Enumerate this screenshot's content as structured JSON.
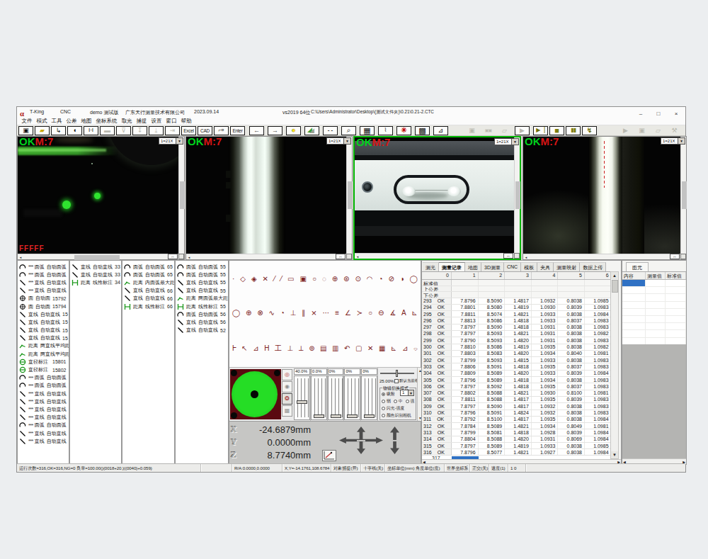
{
  "title": {
    "logo": "α",
    "app_name": "T-King",
    "mode": "CNC",
    "user": "demo 测试版",
    "company": "广东天行测量技术有限公司",
    "date": "2023.09.14",
    "build": "vs2019 64位",
    "file_path": "C:\\Users\\Administrator\\Desktop\\(测试文件夹)\\0.21\\0.21-2.CTC",
    "minimize": "–",
    "maximize": "□",
    "close": "×"
  },
  "menu": [
    "文件",
    "模式",
    "工具",
    "公差",
    "地图",
    "坐标系统",
    "取光",
    "捕捉",
    "设置",
    "窗口",
    "帮助"
  ],
  "toolbar": [
    {
      "name": "save-button",
      "icon": "save",
      "flags": ""
    },
    {
      "name": "open-button",
      "icon": "open",
      "flags": ""
    },
    {
      "name": "probe-button",
      "icon": "probe",
      "flags": ""
    },
    {
      "name": "shield-button",
      "icon": "shield",
      "flags": ""
    },
    {
      "name": "caliper-button",
      "icon": "caliper",
      "flags": ""
    },
    {
      "name": "gray-rect-button",
      "icon": "grayrect",
      "flags": "dis"
    },
    {
      "name": "bucket-down-button",
      "icon": "bucket-down",
      "flags": "dis"
    },
    {
      "name": "caliper-down-button",
      "icon": "caliper-down",
      "flags": "dis"
    },
    {
      "name": "rect-down-button",
      "icon": "rect-down",
      "flags": "dis"
    },
    {
      "name": "arrow-down-button",
      "icon": "arrow-down",
      "flags": "dis"
    },
    {
      "name": "excel-button",
      "label": "Excel",
      "flags": ""
    },
    {
      "name": "cad-button",
      "label": "CAD",
      "flags": ""
    },
    {
      "name": "pipe-button",
      "icon": "pipe",
      "flags": ""
    },
    {
      "name": "enter-button",
      "label": "Enter",
      "flags": ""
    },
    {
      "name": "back-button",
      "icon": "arrow-left",
      "flags": "ga w5"
    },
    {
      "name": "forward-button",
      "icon": "arrow-right",
      "flags": "w5"
    },
    {
      "name": "light-bulb-button",
      "icon": "bulb",
      "flags": "w5"
    },
    {
      "name": "image-button",
      "icon": "image",
      "flags": "w5"
    },
    {
      "name": "dashes-button",
      "icon": "dashes",
      "flags": "w5"
    },
    {
      "name": "zoom-cancel-button",
      "icon": "zoom-cancel",
      "flags": "w5"
    },
    {
      "name": "checker-button",
      "icon": "checker",
      "flags": "w5"
    },
    {
      "name": "marquee-button",
      "icon": "marquee",
      "flags": "w5"
    },
    {
      "name": "burst-button",
      "icon": "burst",
      "flags": "w5"
    },
    {
      "name": "qr-button",
      "icon": "qr",
      "flags": "w5"
    },
    {
      "name": "chart-button",
      "icon": "chart",
      "flags": ""
    },
    {
      "name": "save-flat-button",
      "icon": "save",
      "flags": "gb flat dis"
    },
    {
      "name": "multisave-flat-button",
      "icon": "multisave",
      "flags": "flat dis"
    },
    {
      "name": "folder-flat-button",
      "icon": "folder",
      "flags": "flat dis"
    },
    {
      "name": "play-button",
      "icon": "play",
      "flags": "gc dis"
    },
    {
      "name": "step-button",
      "icon": "step",
      "flags": "gd"
    },
    {
      "name": "stop-button",
      "icon": "stop",
      "flags": ""
    },
    {
      "name": "pause-button",
      "icon": "pause",
      "flags": ""
    },
    {
      "name": "run-button",
      "icon": "run",
      "flags": ""
    },
    {
      "name": "play2-flat-button",
      "icon": "play",
      "flags": "ge flat dis"
    },
    {
      "name": "save2-flat-button",
      "icon": "save",
      "flags": "flat dis"
    },
    {
      "name": "folder2-flat-button",
      "icon": "folder",
      "flags": "flat dis"
    },
    {
      "name": "tools-flat-button",
      "icon": "tools",
      "flags": "flat dis"
    }
  ],
  "cameras": [
    {
      "status": "OK",
      "marker": "M:7",
      "zoom": "1=21X",
      "overlay": "FFFFF"
    },
    {
      "status": "OK",
      "marker": "M:7",
      "zoom": "1=21X"
    },
    {
      "status": "OK",
      "marker": "M:7",
      "zoom": "1=21X",
      "selected": true
    },
    {
      "status": "OK",
      "marker": "M:7",
      "zoom": "1=21X"
    }
  ],
  "lists": {
    "col1": [
      {
        "icon": "arc-icon",
        "stars": "***",
        "name": "圆弧",
        "type": "自动圆弧",
        "num": ""
      },
      {
        "icon": "arc-icon",
        "stars": "***",
        "name": "圆弧",
        "type": "自动圆弧",
        "num": ""
      },
      {
        "icon": "line-icon",
        "stars": "***",
        "name": "直线",
        "type": "自动直线",
        "num": ""
      },
      {
        "icon": "line-icon",
        "stars": "***",
        "name": "直线",
        "type": "自动直线",
        "num": ""
      },
      {
        "icon": "circle-icon",
        "stars": "",
        "name": "圆",
        "type": "自动圆",
        "num": "15792"
      },
      {
        "icon": "circle-icon",
        "stars": "",
        "name": "圆",
        "type": "自动圆",
        "num": "15794"
      },
      {
        "icon": "line-icon",
        "stars": "",
        "name": "直线",
        "type": "自动直线",
        "num": "15"
      },
      {
        "icon": "line-icon",
        "stars": "",
        "name": "直线",
        "type": "自动直线",
        "num": "15"
      },
      {
        "icon": "line-icon",
        "stars": "",
        "name": "直线",
        "type": "自动直线",
        "num": "15"
      },
      {
        "icon": "line-icon",
        "stars": "",
        "name": "直线",
        "type": "自动直线",
        "num": "15"
      },
      {
        "icon": "distance-icon",
        "stars": "",
        "name": "距离",
        "type": "两直线平均距离",
        "num": "",
        "cls": "green"
      },
      {
        "icon": "distance-icon",
        "stars": "",
        "name": "距离",
        "type": "两直线平均距离",
        "num": "",
        "cls": "green"
      },
      {
        "icon": "diameter-icon",
        "stars": "",
        "name": "直径标注",
        "type": "",
        "num": "15801",
        "cls": "green"
      },
      {
        "icon": "diameter-icon",
        "stars": "",
        "name": "直径标注",
        "type": "",
        "num": "15802",
        "cls": "green"
      },
      {
        "icon": "arc-icon",
        "stars": "***",
        "name": "圆弧",
        "type": "自动圆弧",
        "num": ""
      },
      {
        "icon": "arc-icon",
        "stars": "***",
        "name": "圆弧",
        "type": "自动圆弧",
        "num": ""
      },
      {
        "icon": "line-icon",
        "stars": "***",
        "name": "直线",
        "type": "自动直线",
        "num": ""
      },
      {
        "icon": "line-icon",
        "stars": "***",
        "name": "直线",
        "type": "自动直线",
        "num": ""
      },
      {
        "icon": "line-icon",
        "stars": "***",
        "name": "直线",
        "type": "自动直线",
        "num": ""
      },
      {
        "icon": "line-icon",
        "stars": "***",
        "name": "直线",
        "type": "自动直线",
        "num": ""
      },
      {
        "icon": "arc-icon",
        "stars": "***",
        "name": "圆弧",
        "type": "自动圆弧",
        "num": ""
      },
      {
        "icon": "line-icon",
        "stars": "***",
        "name": "直线",
        "type": "自动直线",
        "num": ""
      },
      {
        "icon": "line-icon",
        "stars": "***",
        "name": "直线",
        "type": "自动直线",
        "num": ""
      }
    ],
    "col2": [
      {
        "icon": "line-icon",
        "stars": "",
        "name": "直线",
        "type": "自动直线",
        "num": "33"
      },
      {
        "icon": "line-icon",
        "stars": "",
        "name": "直线",
        "type": "自动直线",
        "num": "33"
      },
      {
        "icon": "linear-icon",
        "stars": "",
        "name": "距离",
        "type": "线性标注",
        "num": "34",
        "cls": "green"
      }
    ],
    "col3": [
      {
        "icon": "arc-icon",
        "stars": "",
        "name": "圆弧",
        "type": "自动圆弧",
        "num": "65"
      },
      {
        "icon": "arc-icon",
        "stars": "",
        "name": "圆弧",
        "type": "自动圆弧",
        "num": "65"
      },
      {
        "icon": "distance-icon",
        "stars": "",
        "name": "距离",
        "type": "内圆弧最大距离",
        "num": "",
        "cls": "green"
      },
      {
        "icon": "line-icon",
        "stars": "",
        "name": "直线",
        "type": "自动直线",
        "num": "66"
      },
      {
        "icon": "line-icon",
        "stars": "",
        "name": "直线",
        "type": "自动直线",
        "num": "66"
      },
      {
        "icon": "linear-icon",
        "stars": "",
        "name": "距离",
        "type": "线性标注",
        "num": "66",
        "cls": "green"
      }
    ],
    "col4": [
      {
        "icon": "arc-icon",
        "stars": "",
        "name": "圆弧",
        "type": "自动圆弧",
        "num": "55"
      },
      {
        "icon": "arc-icon",
        "stars": "",
        "name": "圆弧",
        "type": "自动圆弧",
        "num": "55"
      },
      {
        "icon": "line-icon",
        "stars": "",
        "name": "直线",
        "type": "自动直线",
        "num": "55"
      },
      {
        "icon": "line-icon",
        "stars": "",
        "name": "直线",
        "type": "自动直线",
        "num": "55"
      },
      {
        "icon": "distance-icon",
        "stars": "",
        "name": "距离",
        "type": "两圆弧最大距离",
        "num": "",
        "cls": "green"
      },
      {
        "icon": "linear-icon",
        "stars": "",
        "name": "距离",
        "type": "线性标注",
        "num": "55",
        "cls": "green"
      },
      {
        "icon": "arc-icon",
        "stars": "",
        "name": "圆弧",
        "type": "自动圆弧",
        "num": "56"
      },
      {
        "icon": "line-icon",
        "stars": "",
        "name": "直线",
        "type": "自动直线",
        "num": "56"
      },
      {
        "icon": "line-icon",
        "stars": "",
        "name": "直线",
        "type": "自动直线",
        "num": "52"
      }
    ]
  },
  "toolgrid": {
    "row1": [
      "·",
      "◇",
      "◈",
      "✕",
      "⁄",
      "⁄",
      "▭",
      "▣",
      "○",
      "◌",
      "⊕",
      "⊛",
      "⊙",
      "◠",
      "◔",
      "⊘",
      "◑",
      "◯"
    ],
    "row2": [
      "◯",
      "⊕",
      "⊗",
      "∿",
      "◔",
      "⊥",
      "∥",
      "⨯",
      "⋯",
      "≡",
      "∠",
      "≻",
      "○",
      "⊖",
      "∡",
      "A",
      "⊾"
    ],
    "row3": [
      "Ⱶ",
      "↖",
      "⊿",
      "H",
      "工",
      "⊥",
      "⟂",
      "⊚",
      "▤",
      "▥",
      "↶",
      "▢",
      "✕",
      "▦",
      "⊾",
      "⊿",
      "⌔"
    ]
  },
  "light": {
    "channels": [
      {
        "label": "40.0%"
      },
      {
        "label": "0.0%"
      },
      {
        "label": "0%"
      },
      {
        "label": "0%"
      },
      {
        "label": "0%"
      }
    ],
    "master_percent": "25.00%",
    "default_mode_label": "默认当前模式",
    "group_label": "物镜切换模式",
    "radio_motor": "吸附",
    "objective_value": "1",
    "level_low": "弱",
    "level_mid": "中",
    "level_high": "强",
    "radio_flash": "闪光-强度",
    "radio_color": "颜色识别相机"
  },
  "coords": {
    "x_label": "X",
    "y_label": "Y",
    "z_label": "Z",
    "x": "-24.6879mm",
    "y": "0.0000mm",
    "z": "8.7740mm"
  },
  "table": {
    "tabs": [
      {
        "label": "测光"
      },
      {
        "label": "测量记录",
        "cls": "active"
      },
      {
        "label": "地图"
      },
      {
        "label": "3D测量"
      },
      {
        "label": "CNC"
      },
      {
        "label": "模板"
      },
      {
        "label": "夹具"
      },
      {
        "label": "测量映射"
      },
      {
        "label": "数据上传"
      }
    ],
    "headers": [
      "0",
      "1",
      "2",
      "3",
      "4",
      "5",
      "6"
    ],
    "tolerance_rows": [
      "标准值",
      "上公差",
      "下公差"
    ],
    "rows": [
      {
        "id": "293",
        "status": "OK",
        "values": [
          "7.8796",
          "8.5090",
          "1.4817",
          "1.0932",
          "0.8038",
          "1.0985"
        ]
      },
      {
        "id": "294",
        "status": "OK",
        "values": [
          "7.8801",
          "8.5080",
          "1.4819",
          "1.0930",
          "0.8039",
          "1.0983"
        ]
      },
      {
        "id": "295",
        "status": "OK",
        "values": [
          "7.8811",
          "8.5074",
          "1.4821",
          "1.0933",
          "0.8038",
          "1.0984"
        ]
      },
      {
        "id": "296",
        "status": "OK",
        "values": [
          "7.8813",
          "8.5086",
          "1.4818",
          "1.0933",
          "0.8037",
          "1.0983"
        ]
      },
      {
        "id": "297",
        "status": "OK",
        "values": [
          "7.8797",
          "8.5090",
          "1.4818",
          "1.0931",
          "0.8038",
          "1.0983"
        ]
      },
      {
        "id": "298",
        "status": "OK",
        "values": [
          "7.8797",
          "8.5093",
          "1.4821",
          "1.0931",
          "0.8038",
          "1.0982"
        ]
      },
      {
        "id": "299",
        "status": "OK",
        "values": [
          "7.8790",
          "8.5093",
          "1.4820",
          "1.0931",
          "0.8038",
          "1.0983"
        ]
      },
      {
        "id": "300",
        "status": "OK",
        "values": [
          "7.8810",
          "8.5086",
          "1.4819",
          "1.0935",
          "0.8038",
          "1.0982"
        ]
      },
      {
        "id": "301",
        "status": "OK",
        "values": [
          "7.8803",
          "8.5083",
          "1.4820",
          "1.0934",
          "0.8040",
          "1.0981"
        ]
      },
      {
        "id": "302",
        "status": "OK",
        "values": [
          "7.8799",
          "8.5093",
          "1.4815",
          "1.0933",
          "0.8038",
          "1.0983"
        ]
      },
      {
        "id": "303",
        "status": "OK",
        "values": [
          "7.8806",
          "8.5091",
          "1.4818",
          "1.0935",
          "0.8037",
          "1.0983"
        ]
      },
      {
        "id": "304",
        "status": "OK",
        "values": [
          "7.8809",
          "8.5089",
          "1.4820",
          "1.0933",
          "0.8039",
          "1.0984"
        ]
      },
      {
        "id": "305",
        "status": "OK",
        "values": [
          "7.8796",
          "8.5089",
          "1.4818",
          "1.0934",
          "0.8038",
          "1.0983"
        ]
      },
      {
        "id": "306",
        "status": "OK",
        "values": [
          "7.8797",
          "8.5092",
          "1.4818",
          "1.0935",
          "0.8037",
          "1.0983"
        ]
      },
      {
        "id": "307",
        "status": "OK",
        "values": [
          "7.8802",
          "8.5088",
          "1.4821",
          "1.0930",
          "0.8100",
          "1.0981"
        ]
      },
      {
        "id": "308",
        "status": "OK",
        "values": [
          "7.8811",
          "8.5088",
          "1.4817",
          "1.0935",
          "0.8039",
          "1.0983"
        ]
      },
      {
        "id": "309",
        "status": "OK",
        "values": [
          "7.8797",
          "8.5090",
          "1.4817",
          "1.0932",
          "0.8038",
          "1.0983"
        ]
      },
      {
        "id": "310",
        "status": "OK",
        "values": [
          "7.8796",
          "8.5091",
          "1.4824",
          "1.0932",
          "0.8038",
          "1.0983"
        ]
      },
      {
        "id": "311",
        "status": "OK",
        "values": [
          "7.8792",
          "8.5100",
          "1.4817",
          "1.0935",
          "0.8038",
          "1.0984"
        ]
      },
      {
        "id": "312",
        "status": "OK",
        "values": [
          "7.8784",
          "8.5089",
          "1.4821",
          "1.0934",
          "0.8049",
          "1.0981"
        ]
      },
      {
        "id": "313",
        "status": "OK",
        "values": [
          "7.8799",
          "8.5081",
          "1.4818",
          "1.0928",
          "0.8039",
          "1.0984"
        ]
      },
      {
        "id": "314",
        "status": "OK",
        "values": [
          "7.8804",
          "8.5088",
          "1.4820",
          "1.0931",
          "0.8069",
          "1.0984"
        ]
      },
      {
        "id": "315",
        "status": "OK",
        "values": [
          "7.8797",
          "8.5089",
          "1.4819",
          "1.0933",
          "0.8038",
          "1.0985"
        ]
      },
      {
        "id": "316",
        "status": "OK",
        "values": [
          "7.8796",
          "8.5077",
          "1.4821",
          "1.0927",
          "0.8038",
          "1.0984"
        ]
      }
    ],
    "partial_row_id": "317"
  },
  "panel": {
    "tab": "图元",
    "headers": [
      "内容",
      "测量值",
      "标准值"
    ]
  },
  "statusbar": [
    "运行次数=316,OK=316,NG=0 良率=100.00()(0018+20.)((0040)+0.059)",
    "",
    "R/A:0.0000,0.0000",
    "X,Y=-14.1761,108.6784",
    "对象捕捉(开)",
    "十字线(关)",
    "坐标单位(mm) 角度单位(度)",
    "世界坐标系",
    "正交(关)",
    "速度(1)",
    "1 0"
  ]
}
